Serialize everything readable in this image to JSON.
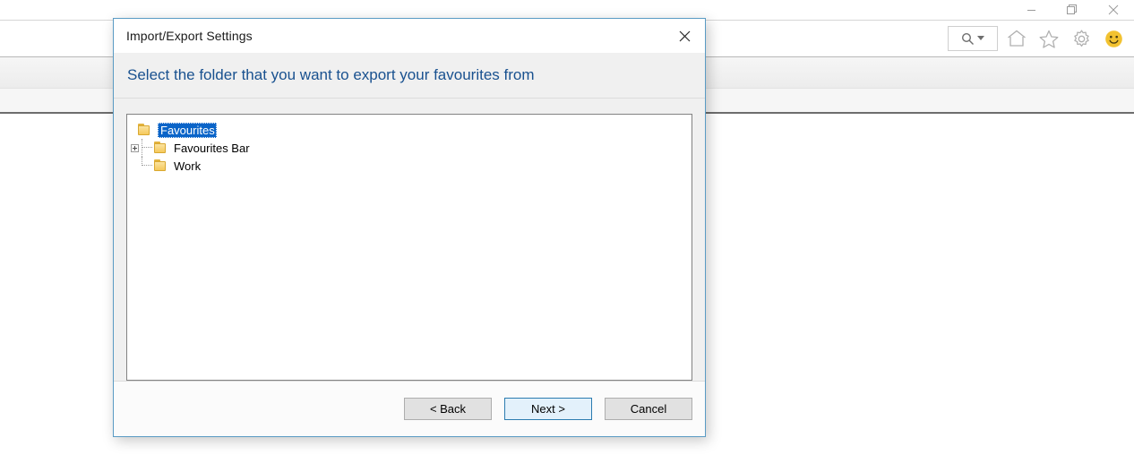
{
  "browser": {
    "window_controls": [
      {
        "name": "minimize",
        "icon": "minimize-icon"
      },
      {
        "name": "restore",
        "icon": "restore-icon"
      },
      {
        "name": "close",
        "icon": "close-icon"
      }
    ],
    "toolbar": {
      "search": {
        "icon": "search-icon",
        "caret": "chevron-down-icon"
      },
      "icons": [
        {
          "name": "home",
          "icon": "home-icon"
        },
        {
          "name": "favorites",
          "icon": "star-icon"
        },
        {
          "name": "tools",
          "icon": "gear-icon"
        },
        {
          "name": "smiley",
          "icon": "smiley-icon"
        }
      ]
    }
  },
  "dialog": {
    "title": "Import/Export Settings",
    "close_label": "✕",
    "header": "Select the folder that you want to export your favourites from",
    "tree": {
      "nodes": [
        {
          "label": "Favourites",
          "level": 0,
          "selected": true,
          "expandable": false,
          "connector": "none"
        },
        {
          "label": "Favourites Bar",
          "level": 1,
          "selected": false,
          "expandable": true,
          "connector": "tee"
        },
        {
          "label": "Work",
          "level": 1,
          "selected": false,
          "expandable": false,
          "connector": "elbow"
        }
      ]
    },
    "buttons": {
      "back": "< Back",
      "next": "Next >",
      "cancel": "Cancel"
    }
  },
  "colors": {
    "dialog_border": "#5a9bc4",
    "header_text": "#19518f",
    "selection": "#0a64c8",
    "default_button_border": "#2c7cb0",
    "folder": "#f5c95c"
  }
}
